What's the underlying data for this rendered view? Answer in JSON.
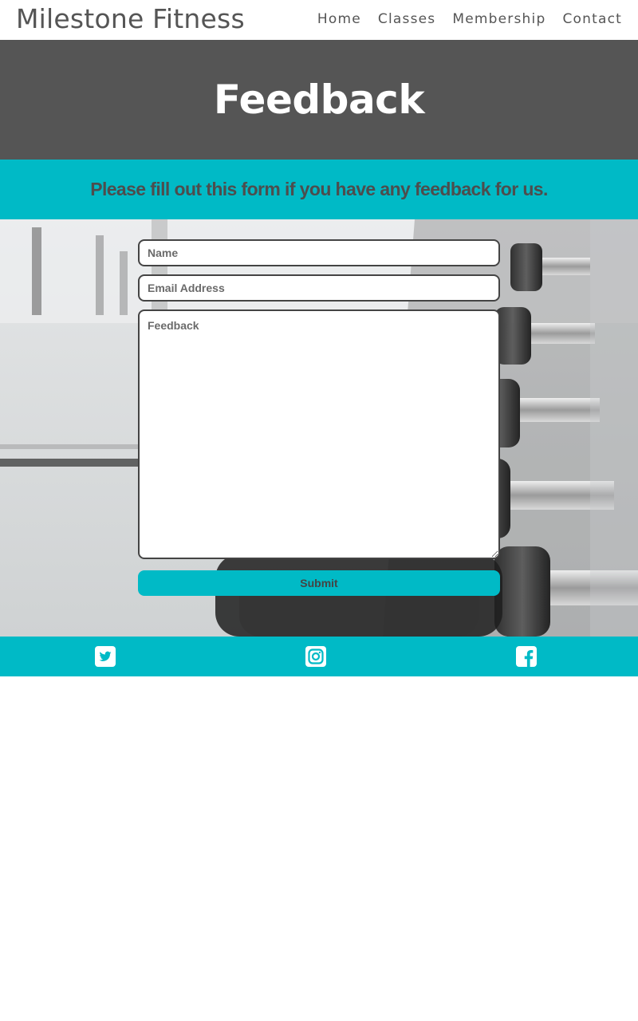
{
  "header": {
    "brand": "Milestone Fitness",
    "nav": [
      "Home",
      "Classes",
      "Membership",
      "Contact"
    ]
  },
  "hero": {
    "title": "Feedback"
  },
  "intro": {
    "text": "Please fill out this form if you have any feedback for us."
  },
  "form": {
    "name_placeholder": "Name",
    "email_placeholder": "Email Address",
    "feedback_placeholder": "Feedback",
    "submit_label": "Submit"
  },
  "footer": {
    "social": [
      {
        "icon": "twitter-square-icon"
      },
      {
        "icon": "instagram-icon"
      },
      {
        "icon": "facebook-square-icon"
      }
    ]
  },
  "colors": {
    "accent": "#00bac6",
    "dark": "#555555",
    "text": "#4d4d4d",
    "white": "#ffffff"
  }
}
